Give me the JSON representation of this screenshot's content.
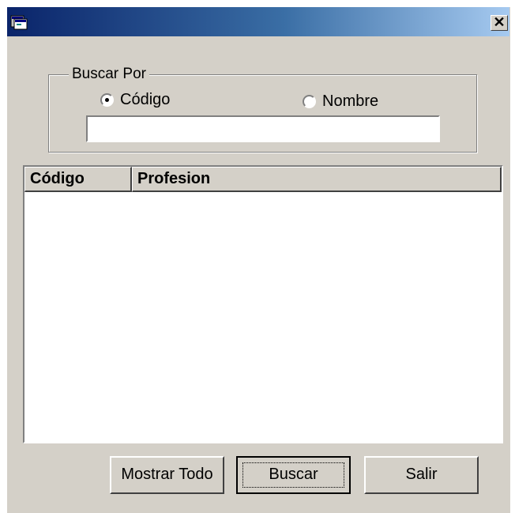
{
  "window": {
    "title": "",
    "close_glyph": "✕",
    "icon": "app-window-icon"
  },
  "search_group": {
    "legend": "Buscar Por",
    "radio_codigo": {
      "label": "Código",
      "checked": true
    },
    "radio_nombre": {
      "label": "Nombre",
      "checked": false
    },
    "input": {
      "value": "",
      "placeholder": ""
    }
  },
  "list": {
    "columns": [
      "Código",
      "Profesion"
    ],
    "rows": []
  },
  "buttons": {
    "mostrar_todo": "Mostrar Todo",
    "buscar": "Buscar",
    "salir": "Salir"
  }
}
